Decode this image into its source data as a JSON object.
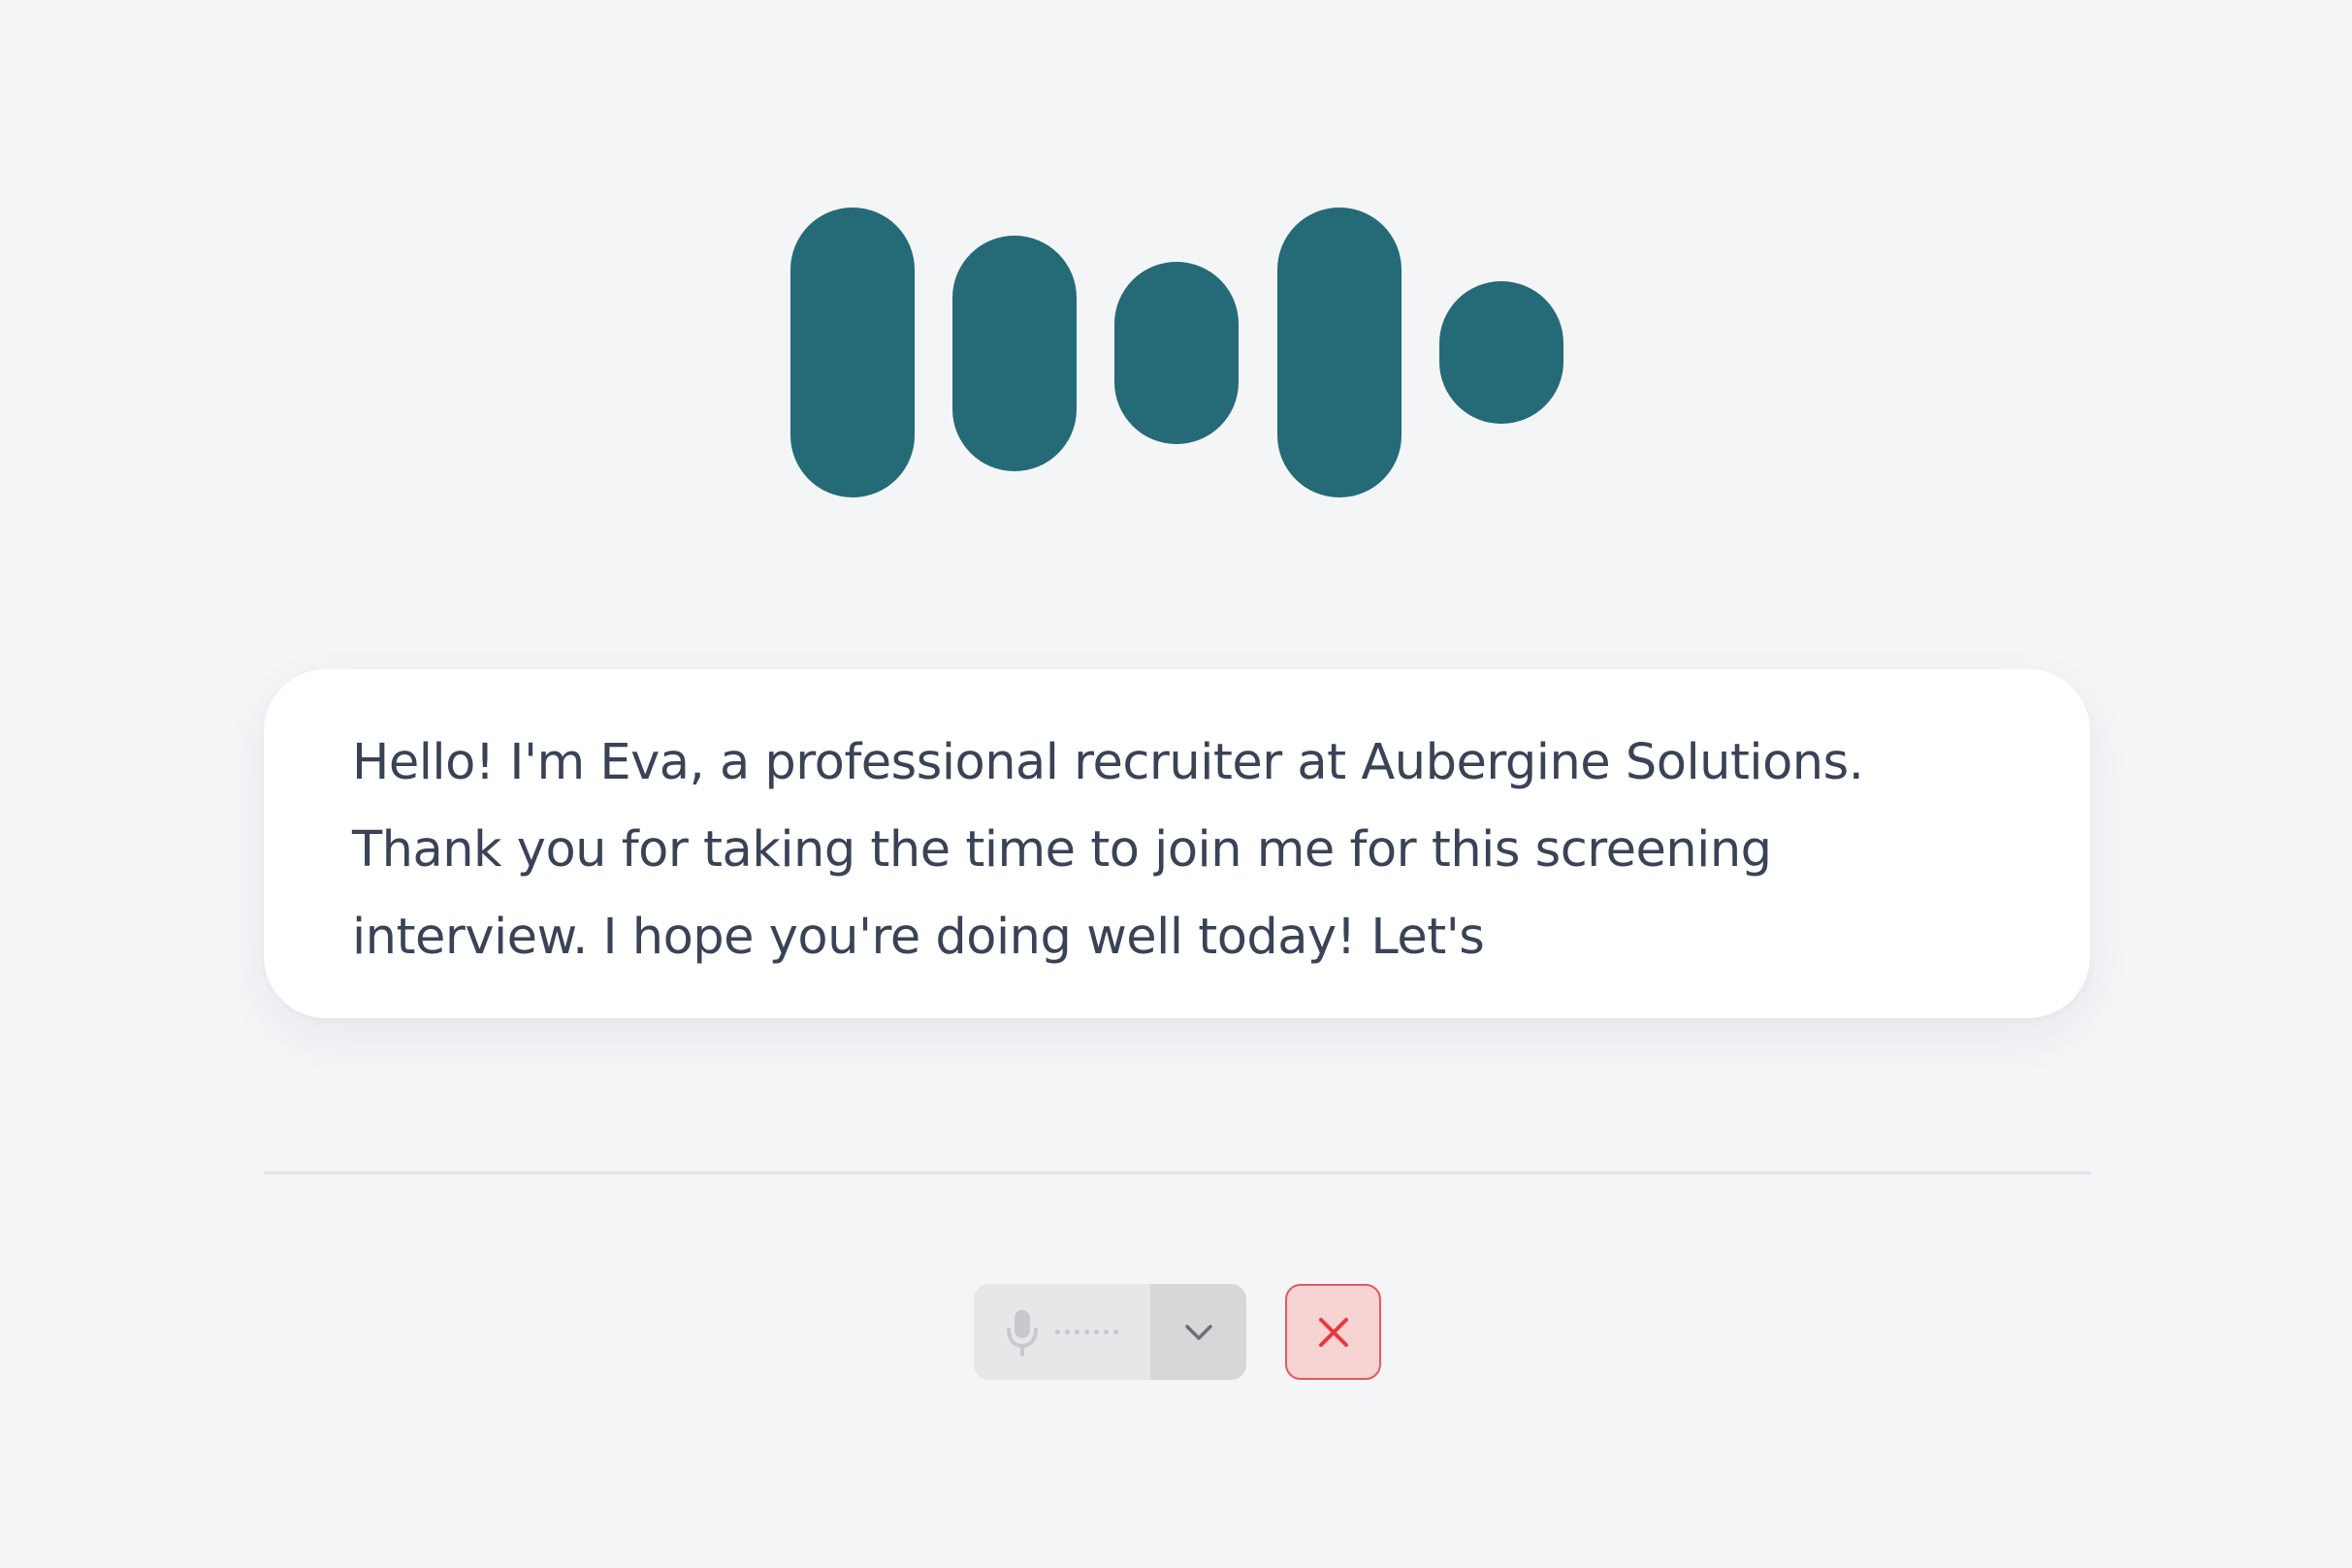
{
  "assistant": {
    "transcript": "Hello! I'm Eva, a professional recruiter at Aubergine Solutions.\nThank you for taking the time to join me for this screening\ninterview. I hope you're doing well today! Let's"
  },
  "colors": {
    "background": "#f3f5f7",
    "visualizer": "#256a77",
    "transcript_text": "#3a4356",
    "end_call_border": "#e25a5e",
    "end_call_fill": "#f7d3d3",
    "end_call_icon": "#e53a3f"
  },
  "controls": {
    "mic_icon": "microphone-icon",
    "dropdown_icon": "chevron-down-icon",
    "end_call_icon": "close-icon",
    "mic_level": 0
  }
}
